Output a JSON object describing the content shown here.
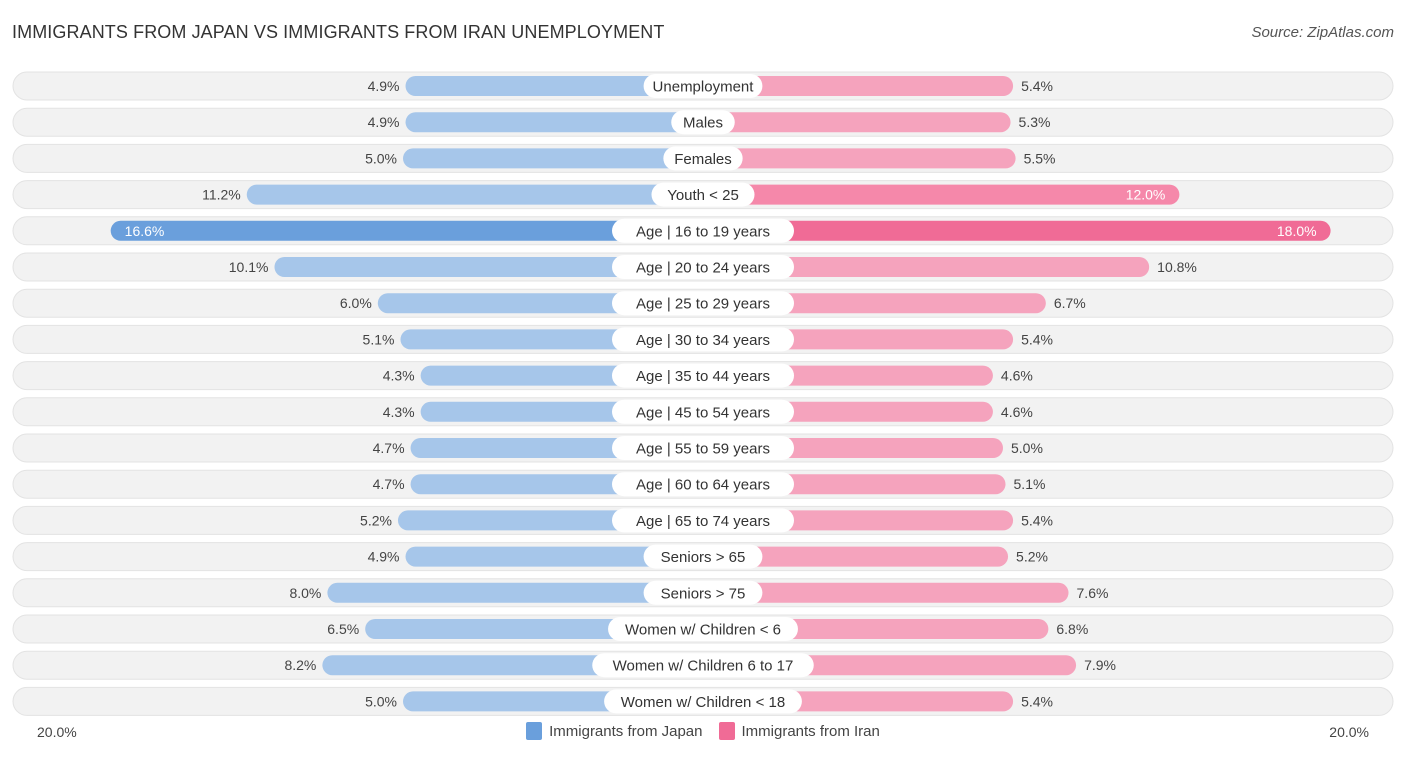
{
  "header": {
    "title": "IMMIGRANTS FROM JAPAN VS IMMIGRANTS FROM IRAN UNEMPLOYMENT",
    "source": "Source: ZipAtlas.com"
  },
  "colors": {
    "japan": "#6a9fdc",
    "japan_light": "#a6c6ea",
    "iran": "#f06b96",
    "iran_light": "#f5a3bd",
    "track": "#f2f2f2"
  },
  "chart_data": {
    "type": "bar",
    "orientation": "horizontal-diverging",
    "title": "IMMIGRANTS FROM JAPAN VS IMMIGRANTS FROM IRAN UNEMPLOYMENT",
    "xlim": [
      0,
      20.0
    ],
    "axis_left_label": "20.0%",
    "axis_right_label": "20.0%",
    "legend_position": "bottom-center",
    "categories": [
      "Unemployment",
      "Males",
      "Females",
      "Youth < 25",
      "Age | 16 to 19 years",
      "Age | 20 to 24 years",
      "Age | 25 to 29 years",
      "Age | 30 to 34 years",
      "Age | 35 to 44 years",
      "Age | 45 to 54 years",
      "Age | 55 to 59 years",
      "Age | 60 to 64 years",
      "Age | 65 to 74 years",
      "Seniors > 65",
      "Seniors > 75",
      "Women w/ Children < 6",
      "Women w/ Children 6 to 17",
      "Women w/ Children < 18"
    ],
    "series": [
      {
        "name": "Immigrants from Japan",
        "side": "left",
        "values": [
          4.9,
          4.9,
          5.0,
          11.2,
          16.6,
          10.1,
          6.0,
          5.1,
          4.3,
          4.3,
          4.7,
          4.7,
          5.2,
          4.9,
          8.0,
          6.5,
          8.2,
          5.0
        ]
      },
      {
        "name": "Immigrants from Iran",
        "side": "right",
        "values": [
          5.4,
          5.3,
          5.5,
          12.0,
          18.0,
          10.8,
          6.7,
          5.4,
          4.6,
          4.6,
          5.0,
          5.1,
          5.4,
          5.2,
          7.6,
          6.8,
          7.9,
          5.4
        ]
      }
    ]
  }
}
